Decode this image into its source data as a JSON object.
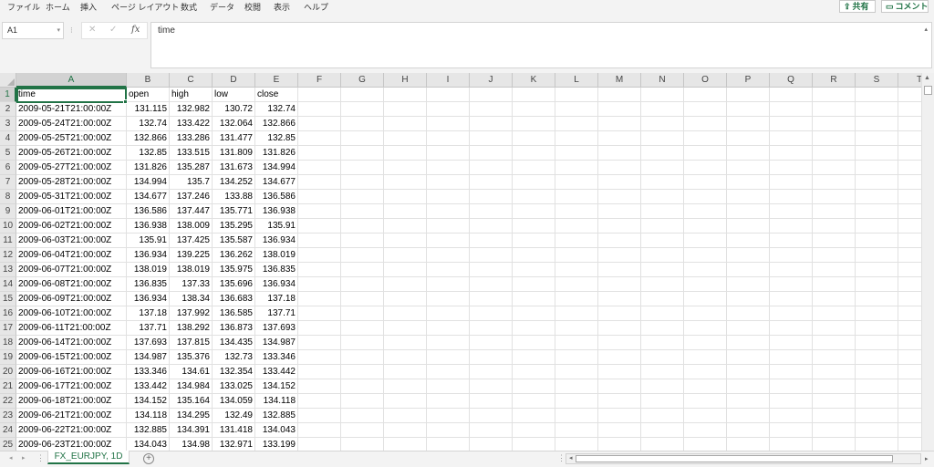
{
  "ribbon": {
    "tabs": [
      "ファイル",
      "ホーム",
      "挿入",
      "ページ レイアウト",
      "数式",
      "データ",
      "校閲",
      "表示",
      "ヘルプ"
    ],
    "share_label": "共有",
    "comment_label": "コメント"
  },
  "formula_bar": {
    "name_box": "A1",
    "fx_label": "fx",
    "content": "time"
  },
  "grid": {
    "columns": [
      "A",
      "B",
      "C",
      "D",
      "E",
      "F",
      "G",
      "H",
      "I",
      "J",
      "K",
      "L",
      "M",
      "N",
      "O",
      "P",
      "Q",
      "R",
      "S",
      "T"
    ],
    "row_numbers": [
      "1",
      "2",
      "3",
      "4",
      "5",
      "6",
      "7",
      "8",
      "9",
      "10",
      "11",
      "12",
      "13",
      "14",
      "15",
      "16",
      "17",
      "18",
      "19",
      "20",
      "21",
      "22",
      "23",
      "24",
      "25"
    ],
    "headers": [
      "time",
      "open",
      "high",
      "low",
      "close"
    ],
    "rows": [
      [
        "2009-05-21T21:00:00Z",
        "131.115",
        "132.982",
        "130.72",
        "132.74"
      ],
      [
        "2009-05-24T21:00:00Z",
        "132.74",
        "133.422",
        "132.064",
        "132.866"
      ],
      [
        "2009-05-25T21:00:00Z",
        "132.866",
        "133.286",
        "131.477",
        "132.85"
      ],
      [
        "2009-05-26T21:00:00Z",
        "132.85",
        "133.515",
        "131.809",
        "131.826"
      ],
      [
        "2009-05-27T21:00:00Z",
        "131.826",
        "135.287",
        "131.673",
        "134.994"
      ],
      [
        "2009-05-28T21:00:00Z",
        "134.994",
        "135.7",
        "134.252",
        "134.677"
      ],
      [
        "2009-05-31T21:00:00Z",
        "134.677",
        "137.246",
        "133.88",
        "136.586"
      ],
      [
        "2009-06-01T21:00:00Z",
        "136.586",
        "137.447",
        "135.771",
        "136.938"
      ],
      [
        "2009-06-02T21:00:00Z",
        "136.938",
        "138.009",
        "135.295",
        "135.91"
      ],
      [
        "2009-06-03T21:00:00Z",
        "135.91",
        "137.425",
        "135.587",
        "136.934"
      ],
      [
        "2009-06-04T21:00:00Z",
        "136.934",
        "139.225",
        "136.262",
        "138.019"
      ],
      [
        "2009-06-07T21:00:00Z",
        "138.019",
        "138.019",
        "135.975",
        "136.835"
      ],
      [
        "2009-06-08T21:00:00Z",
        "136.835",
        "137.33",
        "135.696",
        "136.934"
      ],
      [
        "2009-06-09T21:00:00Z",
        "136.934",
        "138.34",
        "136.683",
        "137.18"
      ],
      [
        "2009-06-10T21:00:00Z",
        "137.18",
        "137.992",
        "136.585",
        "137.71"
      ],
      [
        "2009-06-11T21:00:00Z",
        "137.71",
        "138.292",
        "136.873",
        "137.693"
      ],
      [
        "2009-06-14T21:00:00Z",
        "137.693",
        "137.815",
        "134.435",
        "134.987"
      ],
      [
        "2009-06-15T21:00:00Z",
        "134.987",
        "135.376",
        "132.73",
        "133.346"
      ],
      [
        "2009-06-16T21:00:00Z",
        "133.346",
        "134.61",
        "132.354",
        "133.442"
      ],
      [
        "2009-06-17T21:00:00Z",
        "133.442",
        "134.984",
        "133.025",
        "134.152"
      ],
      [
        "2009-06-18T21:00:00Z",
        "134.152",
        "135.164",
        "134.059",
        "134.118"
      ],
      [
        "2009-06-21T21:00:00Z",
        "134.118",
        "134.295",
        "132.49",
        "132.885"
      ],
      [
        "2009-06-22T21:00:00Z",
        "132.885",
        "134.391",
        "131.418",
        "134.043"
      ],
      [
        "2009-06-23T21:00:00Z",
        "134.043",
        "134.98",
        "132.971",
        "133.199"
      ]
    ]
  },
  "sheet_tabs": [
    "FX_EURJPY, 1D"
  ],
  "colors": {
    "accent": "#217346"
  }
}
